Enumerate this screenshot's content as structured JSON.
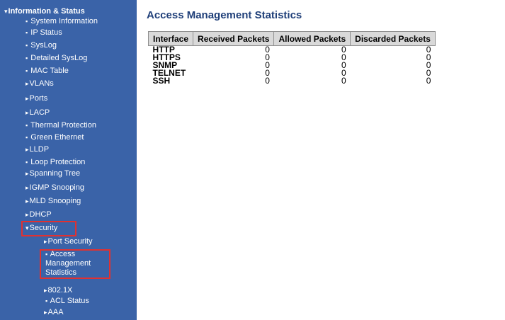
{
  "sidebar": {
    "items": [
      {
        "glyph": "▾",
        "label": "Information & Status"
      },
      {
        "glyph": "▪",
        "label": "System Information"
      },
      {
        "glyph": "▪",
        "label": "IP Status"
      },
      {
        "glyph": "▪",
        "label": "SysLog"
      },
      {
        "glyph": "▪",
        "label": "Detailed SysLog"
      },
      {
        "glyph": "▪",
        "label": "MAC Table"
      },
      {
        "glyph": "▸",
        "label": "VLANs"
      },
      {
        "glyph": "▸",
        "label": "Ports"
      },
      {
        "glyph": "▸",
        "label": "LACP"
      },
      {
        "glyph": "▪",
        "label": "Thermal Protection"
      },
      {
        "glyph": "▪",
        "label": "Green Ethernet"
      },
      {
        "glyph": "▸",
        "label": "LLDP"
      },
      {
        "glyph": "▪",
        "label": "Loop Protection"
      },
      {
        "glyph": "▸",
        "label": "Spanning Tree"
      },
      {
        "glyph": "▸",
        "label": "IGMP Snooping"
      },
      {
        "glyph": "▸",
        "label": "MLD Snooping"
      },
      {
        "glyph": "▸",
        "label": "DHCP"
      },
      {
        "glyph": "▾",
        "label": "Security"
      },
      {
        "glyph": "▸",
        "label": "Port Security"
      },
      {
        "glyph": "▪",
        "label": "Access Management Statistics"
      },
      {
        "glyph": "▸",
        "label": "802.1X"
      },
      {
        "glyph": "▪",
        "label": "ACL Status"
      },
      {
        "glyph": "▸",
        "label": "AAA"
      }
    ]
  },
  "main": {
    "title": "Access Management Statistics",
    "table": {
      "headers": [
        "Interface",
        "Received Packets",
        "Allowed Packets",
        "Discarded Packets"
      ],
      "rows": [
        {
          "interface": "HTTP",
          "received": "0",
          "allowed": "0",
          "discarded": "0"
        },
        {
          "interface": "HTTPS",
          "received": "0",
          "allowed": "0",
          "discarded": "0"
        },
        {
          "interface": "SNMP",
          "received": "0",
          "allowed": "0",
          "discarded": "0"
        },
        {
          "interface": "TELNET",
          "received": "0",
          "allowed": "0",
          "discarded": "0"
        },
        {
          "interface": "SSH",
          "received": "0",
          "allowed": "0",
          "discarded": "0"
        }
      ]
    }
  },
  "colors": {
    "sidebar_bg": "#3a63a8",
    "highlight_box": "#e03131",
    "title_color": "#1f3f79",
    "header_bg": "#d9d9d9"
  }
}
